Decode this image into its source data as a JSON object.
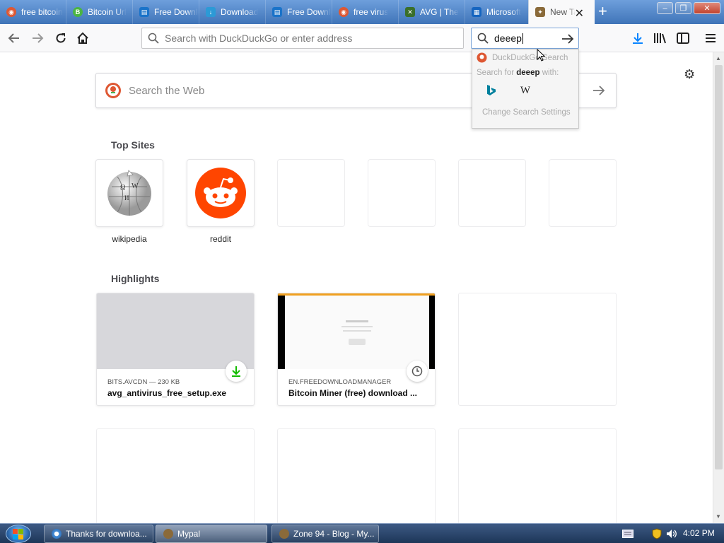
{
  "tabs": [
    {
      "label": "free bitcoin",
      "icon": "duckduckgo-icon",
      "color": "#de5833"
    },
    {
      "label": "Bitcoin Url",
      "icon": "bitcoin-favicon-icon",
      "color": "#4bb543"
    },
    {
      "label": "Free Download",
      "icon": "fdm-favicon-icon",
      "color": "#1a73c9"
    },
    {
      "label": "Download",
      "icon": "download-favicon-icon",
      "color": "#2c9ad6"
    },
    {
      "label": "Free Download",
      "icon": "fdm-favicon-icon",
      "color": "#1a73c9"
    },
    {
      "label": "free virus",
      "icon": "duckduckgo-icon",
      "color": "#de5833"
    },
    {
      "label": "AVG | The",
      "icon": "avg-favicon-icon",
      "color": "#3a6f2a"
    },
    {
      "label": "Microsoft",
      "icon": "microsoft-favicon-icon",
      "color": "#1565c0"
    },
    {
      "label": "New Tab",
      "icon": "newtab-favicon-icon",
      "color": "#8a6a3a",
      "active": true
    }
  ],
  "toolbar": {
    "url_placeholder": "Search with DuckDuckGo or enter address",
    "search_value": "deeep"
  },
  "search_popup": {
    "engine_header": "DuckDuckGo Search",
    "hint_prefix": "Search for ",
    "hint_query": "deeep",
    "hint_suffix": " with:",
    "engines": [
      "bing",
      "wikipedia"
    ],
    "change_label": "Change Search Settings"
  },
  "newtab": {
    "search_placeholder": "Search the Web",
    "top_sites_title": "Top Sites",
    "top_sites": [
      {
        "label": "wikipedia"
      },
      {
        "label": "reddit"
      },
      {
        "label": ""
      },
      {
        "label": ""
      },
      {
        "label": ""
      },
      {
        "label": ""
      }
    ],
    "highlights_title": "Highlights",
    "highlights": [
      {
        "source": "BITS.AVCDN — 230 KB",
        "title": "avg_antivirus_free_setup.exe",
        "badge": "download-icon"
      },
      {
        "source": "EN.FREEDOWNLOADMANAGER",
        "title": "Bitcoin Miner (free) download ...",
        "badge": "history-icon"
      }
    ]
  },
  "taskbar": {
    "tasks": [
      {
        "label": "Thanks for downloa..."
      },
      {
        "label": "Mypal"
      },
      {
        "label": "Zone 94 - Blog - My..."
      }
    ],
    "clock": "4:02 PM"
  },
  "colors": {
    "accent_blue": "#0a84ff",
    "download_green": "#12bc00",
    "reddit_orange": "#ff4500",
    "ddg_orange": "#de5833",
    "tabstrip_blue": "#4a7fc1"
  }
}
